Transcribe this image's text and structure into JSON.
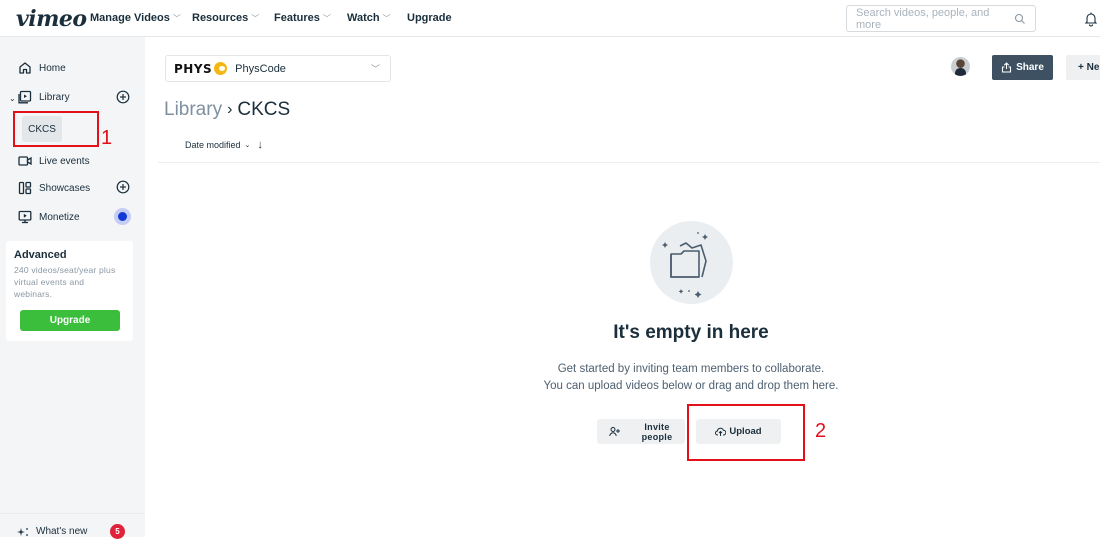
{
  "topnav": {
    "logo": "vimeo",
    "items": [
      {
        "label": "Manage Videos",
        "has_dropdown": true
      },
      {
        "label": "Resources",
        "has_dropdown": true
      },
      {
        "label": "Features",
        "has_dropdown": true
      },
      {
        "label": "Watch",
        "has_dropdown": true
      },
      {
        "label": "Upgrade",
        "has_dropdown": false
      }
    ],
    "search_placeholder": "Search videos, people, and more",
    "icons": {
      "search": "search-icon",
      "notifications": "bell-icon"
    }
  },
  "sidebar": {
    "items": [
      {
        "label": "Home",
        "icon": "home-icon"
      },
      {
        "label": "Library",
        "icon": "library-icon",
        "expanded": true,
        "has_add": true
      },
      {
        "label": "CKCS",
        "selected": true
      },
      {
        "label": "Live events",
        "icon": "live-events-icon"
      },
      {
        "label": "Showcases",
        "icon": "showcases-icon",
        "has_add": true
      },
      {
        "label": "Monetize",
        "icon": "monetize-icon",
        "has_indicator": true
      }
    ],
    "plan": {
      "title": "Advanced",
      "description": "240 videos/seat/year plus virtual events and webinars.",
      "button": "Upgrade",
      "button_color": "#3bbe3b"
    },
    "whats_new": {
      "label": "What's new",
      "badge": "5"
    }
  },
  "main": {
    "team": {
      "brand": "PHYS",
      "name": "PhysCode"
    },
    "breadcrumb": {
      "parent": "Library",
      "separator": "›",
      "current": "CKCS"
    },
    "sort": {
      "label": "Date modified",
      "direction": "descending"
    },
    "actions": {
      "share": "Share",
      "new": "+ Ne"
    },
    "empty_state": {
      "title": "It's empty in here",
      "line1": "Get started by inviting team members to collaborate.",
      "line2": "You can upload videos below or drag and drop them here.",
      "invite_line1": "Invite",
      "invite_line2": "people",
      "upload": "Upload"
    }
  },
  "annotations": [
    {
      "number": "1",
      "target": "CKCS"
    },
    {
      "number": "2",
      "target": "Upload"
    }
  ],
  "colors": {
    "primary_text": "#1a2e3b",
    "sidebar_bg": "#f4f5f7",
    "share_bg": "#3d5163",
    "annotation": "#e3101a",
    "badge": "#e0223b",
    "monetize_dot": "#1039d6"
  }
}
